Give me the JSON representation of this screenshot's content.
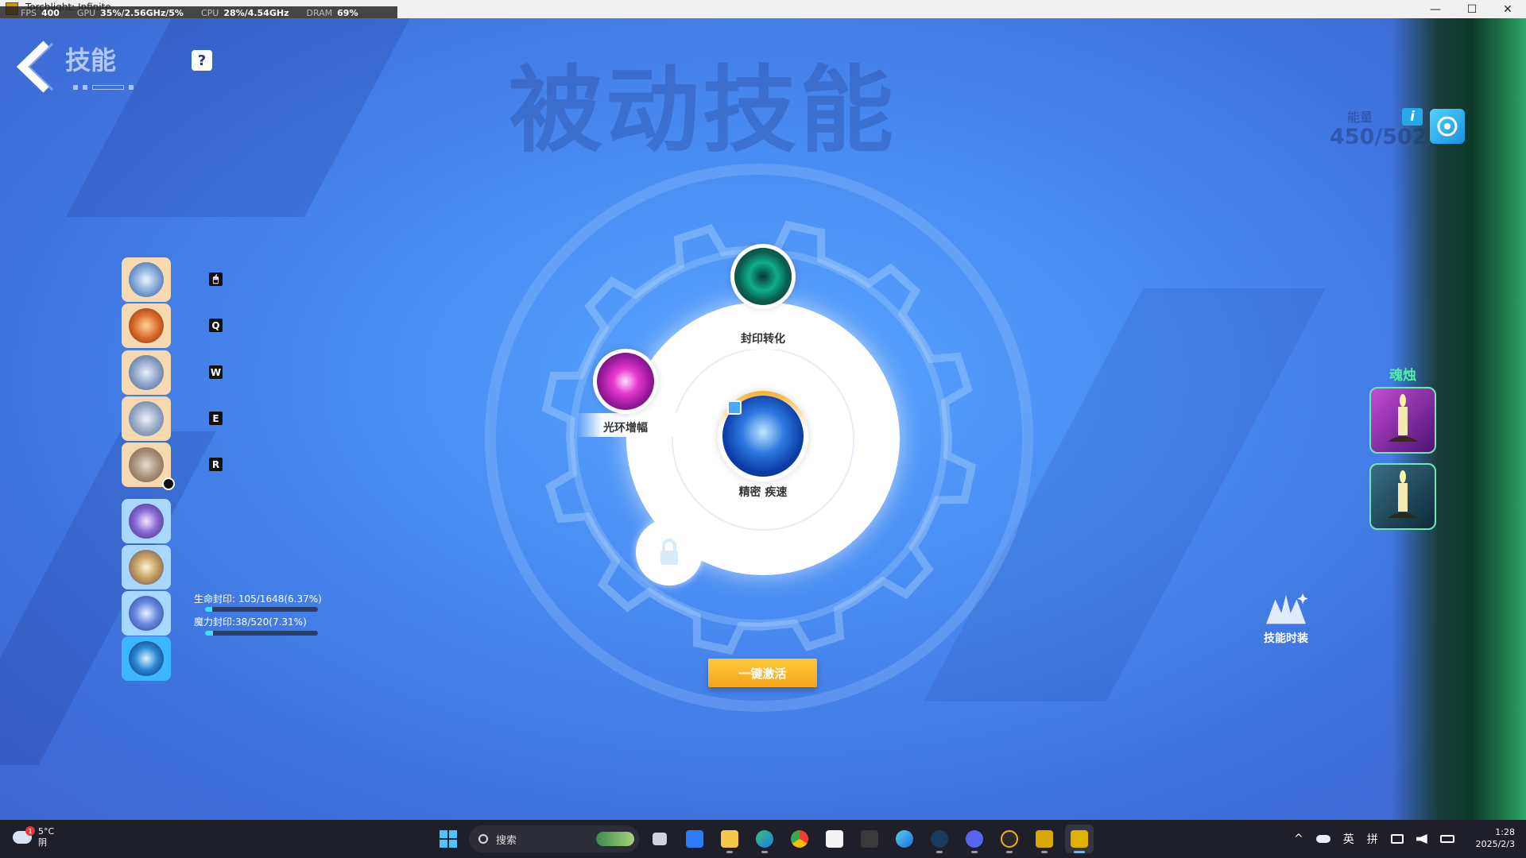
{
  "window": {
    "title": "Torchlight: Infinite",
    "minimize_glyph": "—",
    "maximize_glyph": "☐",
    "close_glyph": "✕"
  },
  "perf_overlay": {
    "fps_label": "FPS",
    "fps_value": "400",
    "gpu_label": "GPU",
    "gpu_value": "35%/2.56GHz/5%",
    "cpu_label": "CPU",
    "cpu_value": "28%/4.54GHz",
    "dram_label": "DRAM",
    "dram_value": "69%"
  },
  "header": {
    "title": "技能",
    "help_label": "?",
    "background_title": "被动技能"
  },
  "energy": {
    "label": "能量",
    "value": "450/502",
    "info_label": "i"
  },
  "skill_slots": [
    {
      "icon": "swirl-orb-icon",
      "key": "🖱",
      "style": "warm"
    },
    {
      "icon": "flame-orb-icon",
      "key": "Q",
      "style": "warm"
    },
    {
      "icon": "wind-orb-icon",
      "key": "W",
      "style": "warm"
    },
    {
      "icon": "spirit-orb-icon",
      "key": "E",
      "style": "warm"
    },
    {
      "icon": "stone-orb-icon",
      "key": "R",
      "style": "warm"
    },
    {
      "icon": "arcane-orb-icon",
      "style": "cool"
    },
    {
      "icon": "slash-orb-icon",
      "style": "cool"
    },
    {
      "icon": "lightning-orb-icon",
      "style": "cool"
    },
    {
      "icon": "storm-orb-icon",
      "style": "active"
    }
  ],
  "seals": {
    "life_label": "生命封印: 105/1648(6.37%)",
    "life_fraction": 0.0637,
    "mana_label": "魔力封印:38/520(7.31%)",
    "mana_fraction": 0.0731
  },
  "passive_wheel": {
    "top_skill": "封印转化",
    "left_skill": "光环增幅",
    "center_skill": "精密 疾速",
    "activate_label": "一键激活"
  },
  "soul_candles": {
    "label": "魂烛"
  },
  "skill_skin": {
    "label": "技能时装"
  },
  "taskbar": {
    "weather_temp": "5°C",
    "weather_desc": "阴",
    "weather_badge": "1",
    "search_placeholder": "搜索",
    "tray_chevron": "^",
    "ime_lang": "英",
    "ime_mode": "拼",
    "clock_time": "1:28",
    "clock_date": "2025/2/3"
  },
  "colors": {
    "accent_orange": "#f7a519",
    "seal_fill": "#3fe0ff",
    "soul_green": "#4ff0a0"
  }
}
